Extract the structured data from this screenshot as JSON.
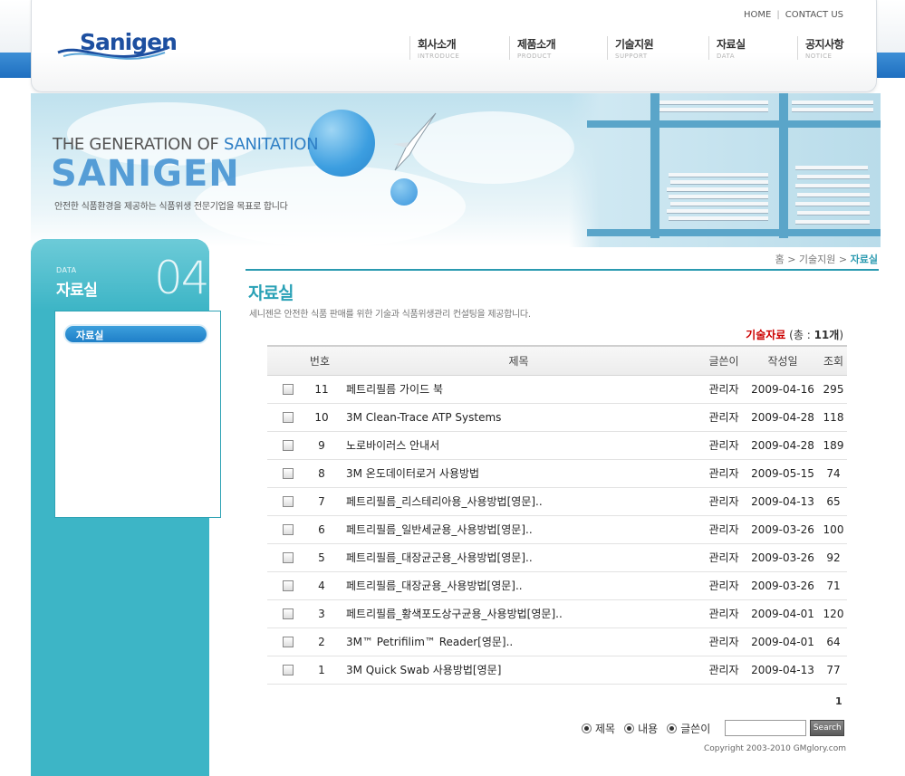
{
  "header": {
    "logo_text": "Sanigen",
    "toplinks": {
      "home": "HOME",
      "contact": "CONTACT US"
    },
    "nav": [
      {
        "ko": "회사소개",
        "en": "INTRODUCE"
      },
      {
        "ko": "제품소개",
        "en": "PRODUCT"
      },
      {
        "ko": "기술지원",
        "en": "SUPPORT"
      },
      {
        "ko": "자료실",
        "en": "DATA"
      },
      {
        "ko": "공지사항",
        "en": "NOTICE"
      }
    ]
  },
  "banner": {
    "line1_a": "THE GENERATION OF ",
    "line1_b": "SANITATION",
    "line2": "SANIGEN",
    "sub": "안전한 식품환경을 제공하는 식품위생 전문기업을 목표로 합니다"
  },
  "breadcrumb": {
    "home": "홈",
    "sep": ">",
    "parent": "기술지원",
    "current": "자료실"
  },
  "sidebar": {
    "data_label": "DATA",
    "title": "자료실",
    "number": "04",
    "items": [
      {
        "label": "자료실"
      }
    ]
  },
  "page": {
    "title": "자료실",
    "description": "세니젠은 안전한 식품 판매를 위한 기술과 식품위생관리 컨설팅을 제공합니다."
  },
  "count": {
    "label": "기술자료",
    "prefix": "(총 : ",
    "value": "11개",
    "suffix": ")"
  },
  "table": {
    "headers": {
      "no": "번호",
      "subject": "제목",
      "writer": "글쓴이",
      "date": "작성일",
      "views": "조회"
    },
    "rows": [
      {
        "no": "11",
        "subject": "페트리필름 가이드 북",
        "writer": "관리자",
        "date": "2009-04-16",
        "views": "295"
      },
      {
        "no": "10",
        "subject": "3M Clean-Trace ATP Systems",
        "writer": "관리자",
        "date": "2009-04-28",
        "views": "118"
      },
      {
        "no": "9",
        "subject": "노로바이러스 안내서",
        "writer": "관리자",
        "date": "2009-04-28",
        "views": "189"
      },
      {
        "no": "8",
        "subject": "3M 온도데이터로거 사용방법",
        "writer": "관리자",
        "date": "2009-05-15",
        "views": "74"
      },
      {
        "no": "7",
        "subject": "페트리필름_리스테리아용_사용방법[영문]..",
        "writer": "관리자",
        "date": "2009-04-13",
        "views": "65"
      },
      {
        "no": "6",
        "subject": "페트리필름_일반세균용_사용방법[영문]..",
        "writer": "관리자",
        "date": "2009-03-26",
        "views": "100"
      },
      {
        "no": "5",
        "subject": "페트리필름_대장균군용_사용방법[영문]..",
        "writer": "관리자",
        "date": "2009-03-26",
        "views": "92"
      },
      {
        "no": "4",
        "subject": "페트리필름_대장균용_사용방법[영문]..",
        "writer": "관리자",
        "date": "2009-03-26",
        "views": "71"
      },
      {
        "no": "3",
        "subject": "페트리필름_황색포도상구균용_사용방법[영문]..",
        "writer": "관리자",
        "date": "2009-04-01",
        "views": "120"
      },
      {
        "no": "2",
        "subject": "3M™ Petrifilim™ Reader[영문]..",
        "writer": "관리자",
        "date": "2009-04-01",
        "views": "64"
      },
      {
        "no": "1",
        "subject": "3M Quick Swab 사용방법[영문]",
        "writer": "관리자",
        "date": "2009-04-13",
        "views": "77"
      }
    ]
  },
  "paging": {
    "current": "1"
  },
  "search": {
    "options": [
      {
        "label": "제목"
      },
      {
        "label": "내용"
      },
      {
        "label": "글쓴이"
      }
    ],
    "input_value": "",
    "button": "Search"
  },
  "copyright": "Copyright 2003-2010 GMglory.com",
  "colors": {
    "accent": "#2aa1b6",
    "sidebar": "#3db5c6",
    "brand_blue": "#1d4fa0",
    "count_red": "#cc0000"
  }
}
